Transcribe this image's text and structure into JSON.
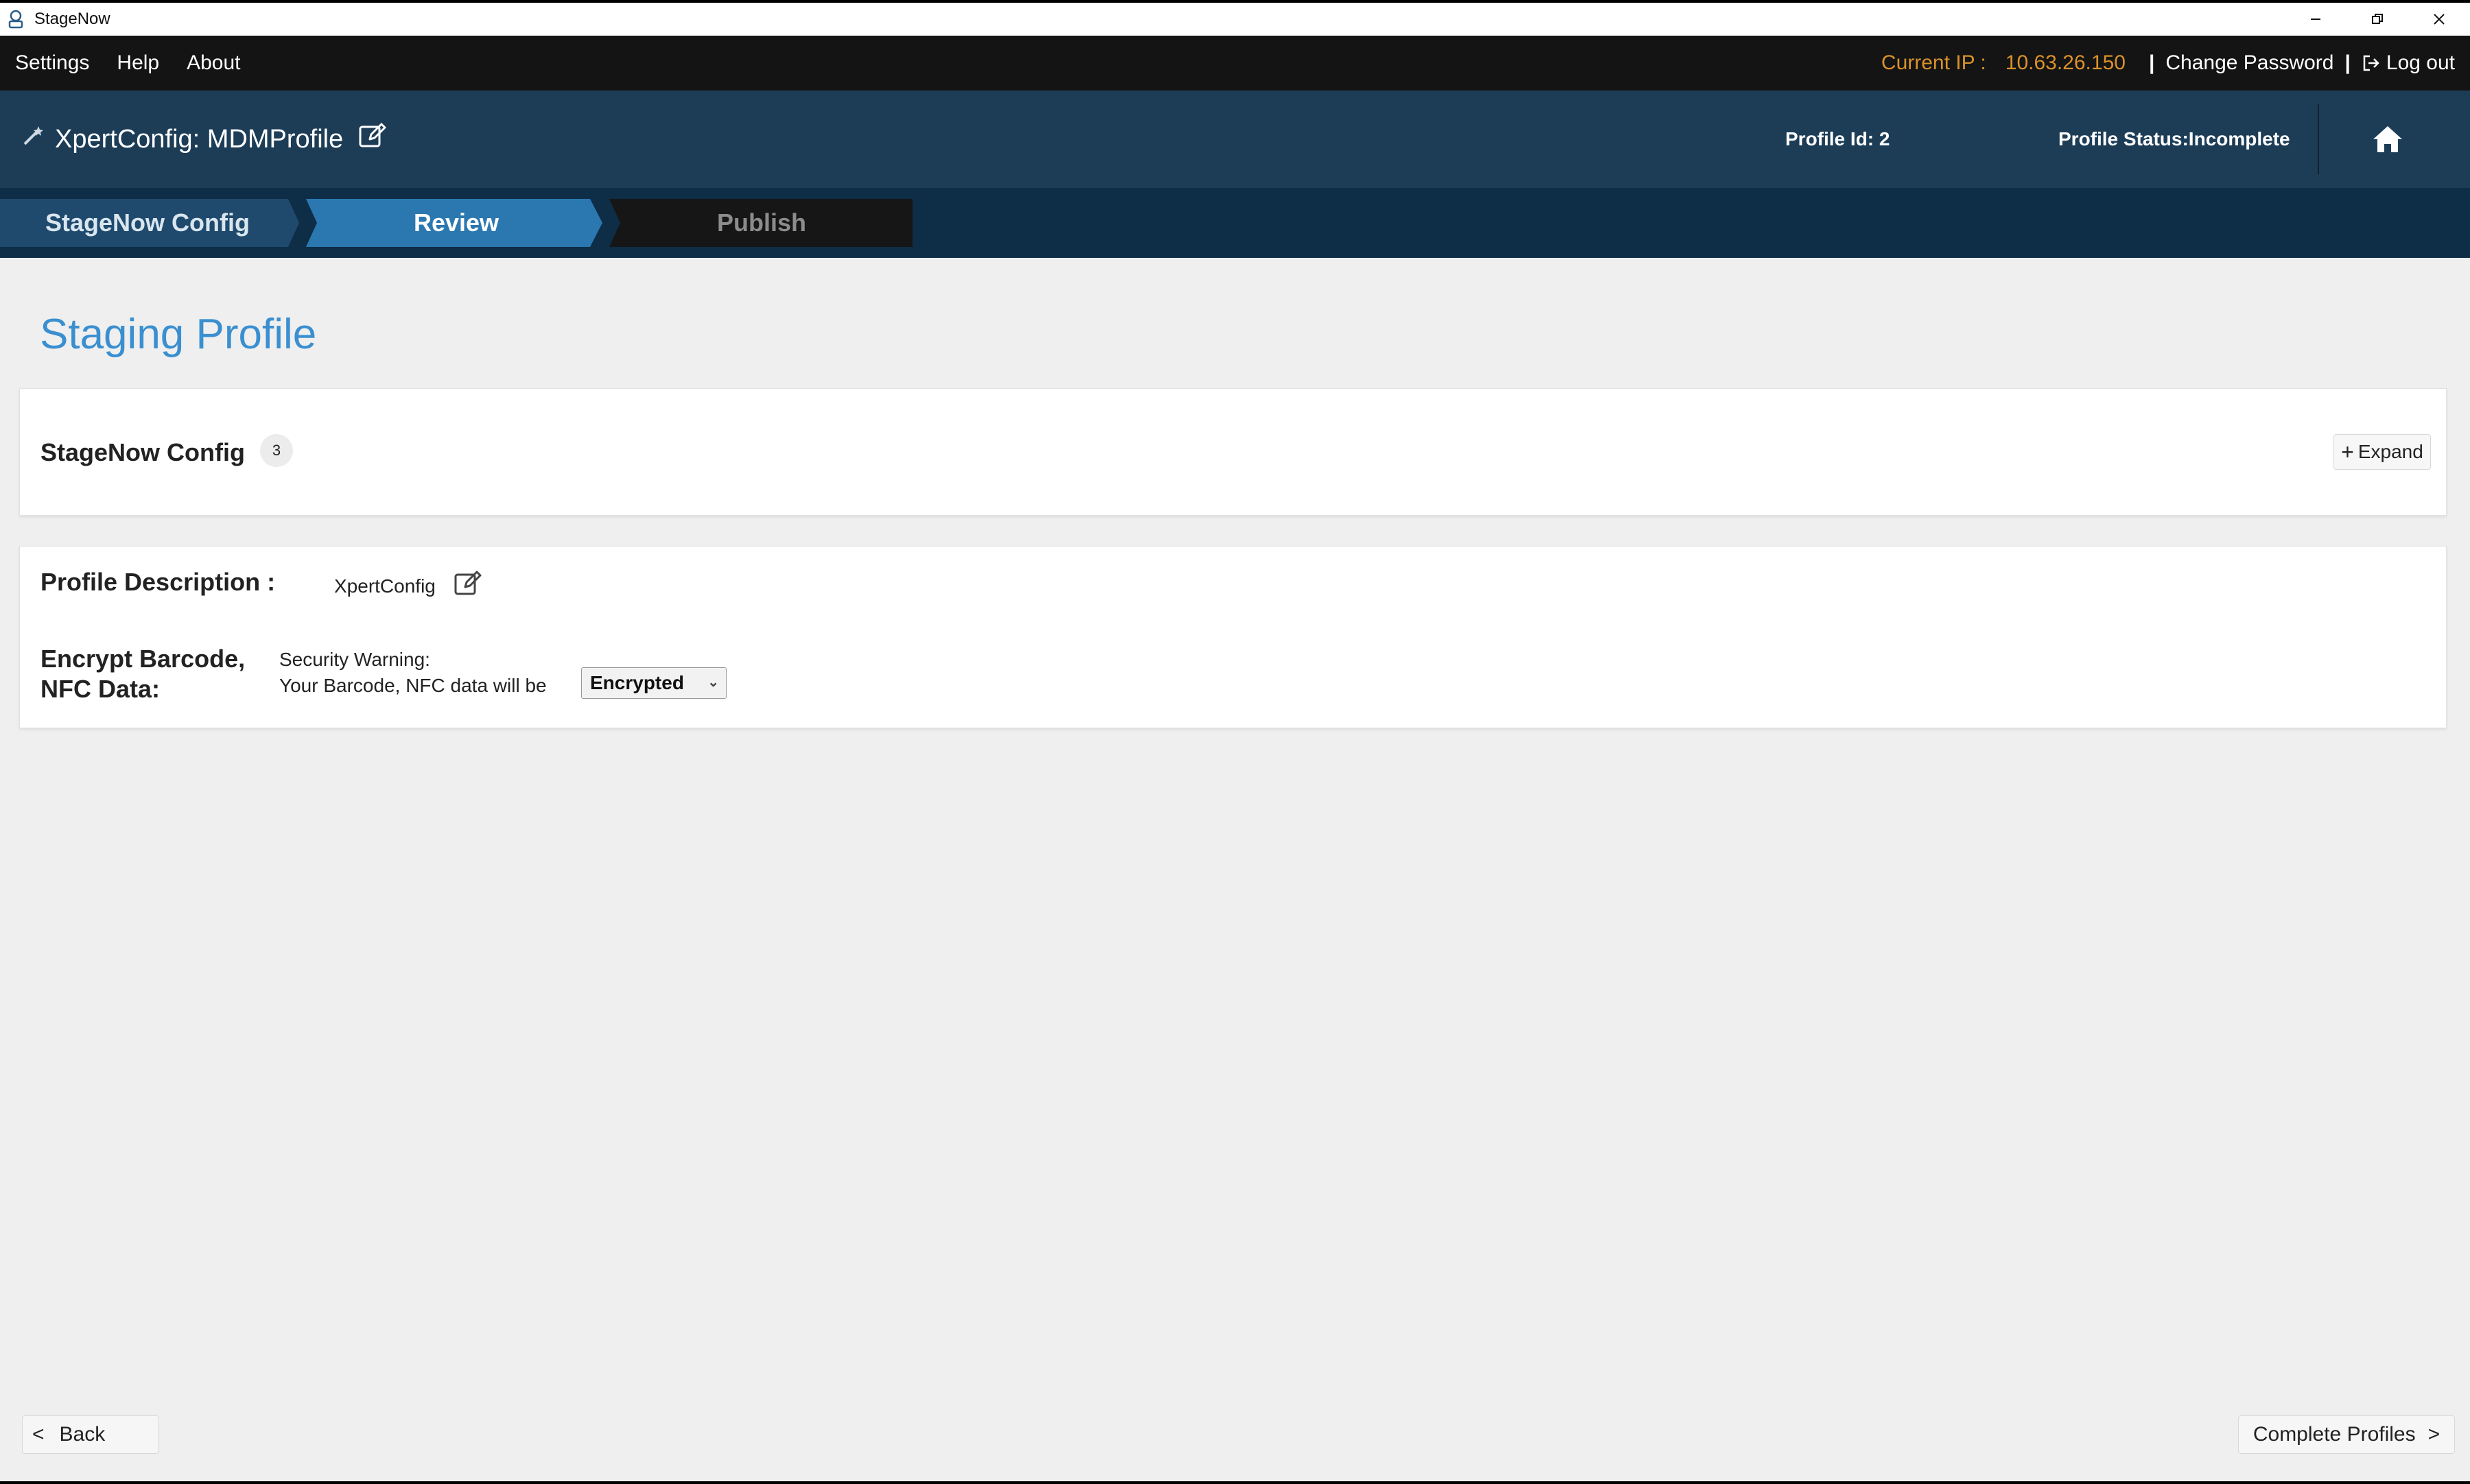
{
  "window": {
    "title": "StageNow"
  },
  "menubar": {
    "items": [
      "Settings",
      "Help",
      "About"
    ],
    "ip_label": "Current IP :",
    "ip_value": "10.63.26.150",
    "separator": "|",
    "change_password": "Change Password",
    "logout": "Log out"
  },
  "profile_header": {
    "title": "XpertConfig: MDMProfile",
    "profile_id": "Profile Id: 2",
    "profile_status": "Profile Status:Incomplete"
  },
  "wizard": {
    "steps": [
      {
        "label": "StageNow Config",
        "state": "done"
      },
      {
        "label": "Review",
        "state": "active"
      },
      {
        "label": "Publish",
        "state": "pending"
      }
    ]
  },
  "content": {
    "page_title": "Staging Profile",
    "config_section": {
      "title": "StageNow Config",
      "count": "3",
      "expand_label": "Expand"
    },
    "profile_description": {
      "label": "Profile Description :",
      "value": "XpertConfig"
    },
    "encrypt": {
      "label_line1": "Encrypt Barcode,",
      "label_line2": "NFC Data:",
      "warning_line1": "Security Warning:",
      "warning_line2": "Your Barcode, NFC data will be",
      "selected": "Encrypted"
    }
  },
  "footer": {
    "back_label": "Back",
    "back_arrow": "<",
    "complete_label": "Complete Profiles",
    "complete_arrow": ">"
  },
  "colors": {
    "menubar_bg": "#141414",
    "header_bg": "#1d3d57",
    "wizard_bg": "#0e2d47",
    "active_step": "#2b78b0",
    "accent_title": "#3a8fd0",
    "ip_color": "#d9912a"
  },
  "icons": [
    "app-icon",
    "minimize-icon",
    "restore-icon",
    "close-icon",
    "wand-icon",
    "edit-icon",
    "home-icon",
    "logout-icon",
    "chevron-down-icon"
  ]
}
